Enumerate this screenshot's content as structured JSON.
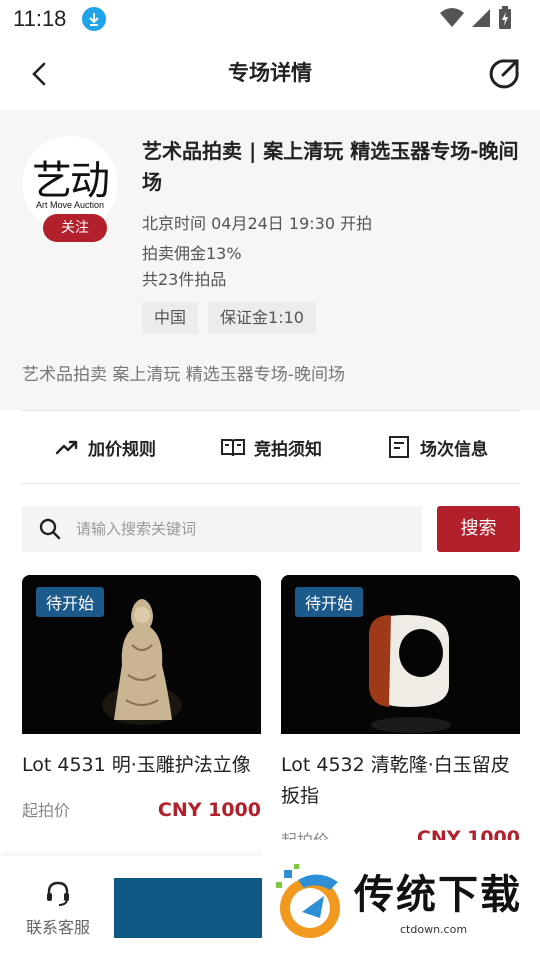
{
  "status_bar": {
    "time": "11:18"
  },
  "nav": {
    "title": "专场详情"
  },
  "auction": {
    "logo_main": "艺动",
    "logo_sub": "Art Move Auction",
    "follow_label": "关注",
    "title": "艺术品拍卖 | 案上清玩 精选玉器专场-晚间场",
    "time_info": "北京时间 04月24日 19:30 开拍",
    "commission": "拍卖佣金13%",
    "lot_count": "共23件拍品",
    "tags": [
      "中国",
      "保证金1:10"
    ],
    "description": "艺术品拍卖 案上清玩 精选玉器专场-晚间场"
  },
  "tabs": [
    {
      "label": "加价规则",
      "icon": "trend-up-icon"
    },
    {
      "label": "竞拍须知",
      "icon": "book-icon"
    },
    {
      "label": "场次信息",
      "icon": "info-board-icon"
    }
  ],
  "search": {
    "placeholder": "请输入搜索关键词",
    "button_label": "搜索"
  },
  "lots": [
    {
      "status": "待开始",
      "name": "Lot 4531 明·玉雕护法立像",
      "start_label": "起拍价",
      "price": "CNY  1000"
    },
    {
      "status": "待开始",
      "name": "Lot 4532 清乾隆·白玉留皮扳指",
      "start_label": "起拍价",
      "price": "CNY  1000"
    }
  ],
  "bottom": {
    "service_label": "联系客服"
  },
  "watermark": {
    "text": "传统下载",
    "url": "ctdown.com"
  },
  "colors": {
    "accent": "#b2202b",
    "status_blue": "#1c5a8c",
    "bottom_block": "#0e5a85"
  }
}
